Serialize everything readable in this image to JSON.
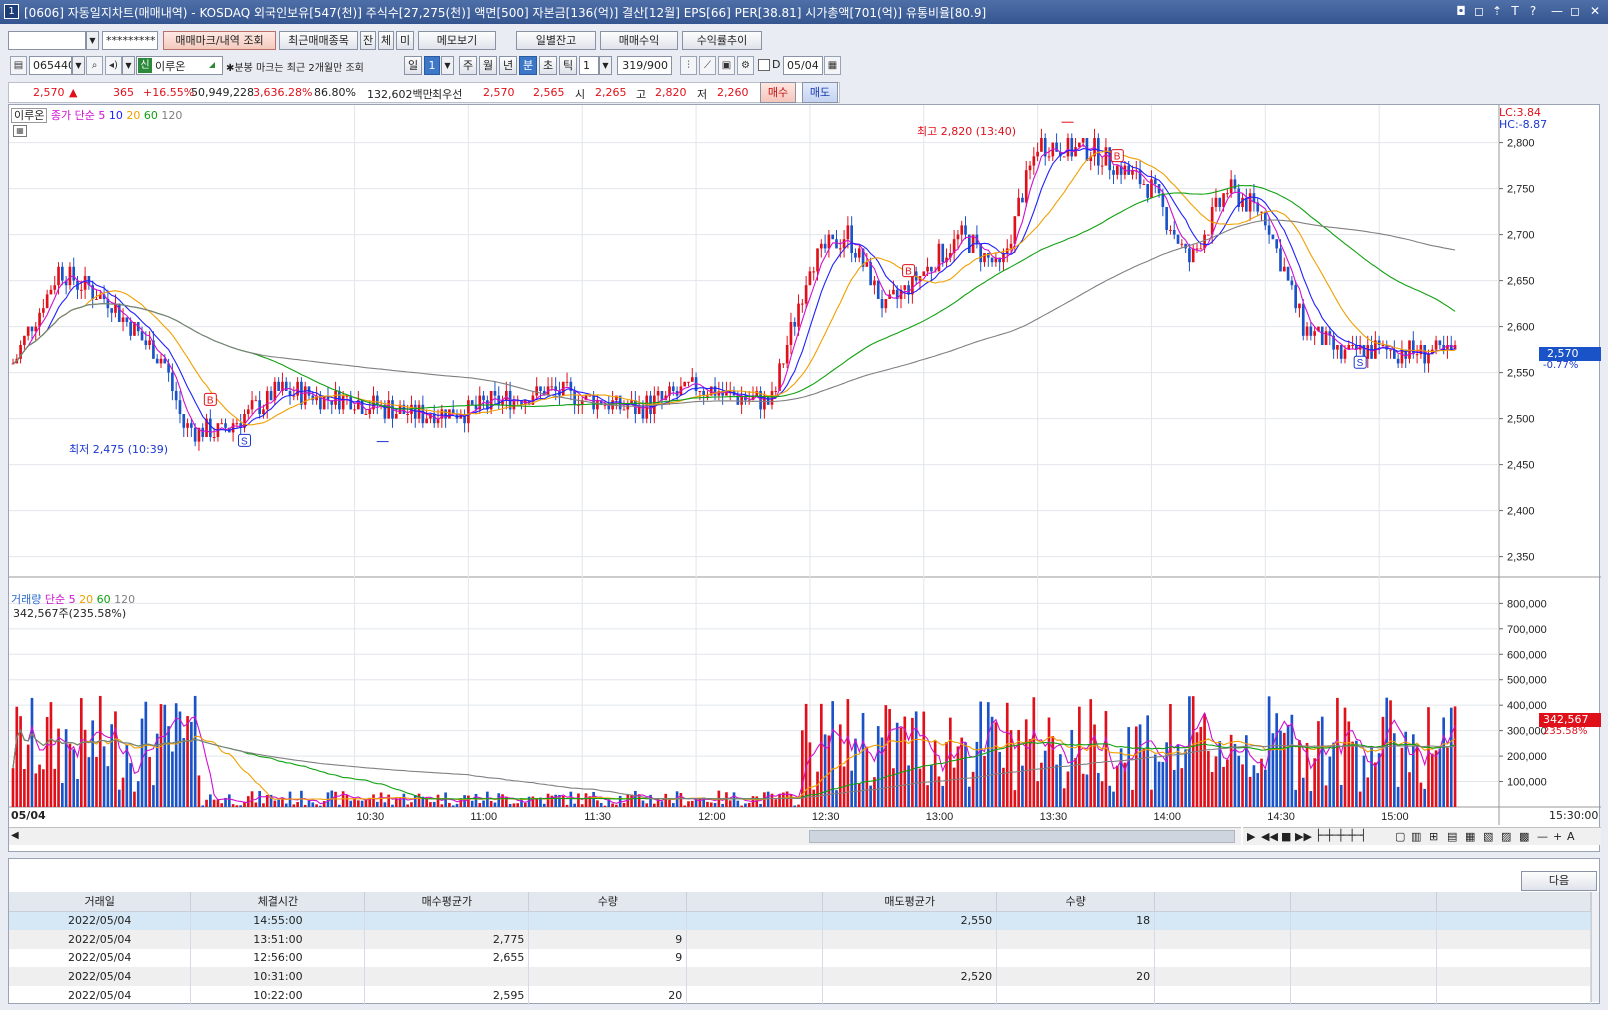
{
  "window": {
    "title": "[0606] 자동일지차트(매매내역) - KOSDAQ 외국인보유[547(천)] 주식수[27,275(천)] 액면[500] 자본금[136(억)] 결산[12월] EPS[66] PER[38.81] 시가총액[701(억)] 유통비율[80.9]",
    "icon": "1",
    "controls": [
      "◘",
      "◻",
      "⇡",
      "T",
      "?",
      "—",
      "◻",
      "✕"
    ]
  },
  "toolbar1": {
    "account_value": "",
    "password": "*********",
    "buttons": [
      "매매마크/내역 조회",
      "최근매매종목",
      "잔",
      "체",
      "미",
      "메모보기",
      "일별잔고",
      "매매수익",
      "수익률추이"
    ]
  },
  "toolbar2": {
    "code": "065440",
    "stock_tag": "신",
    "stock_name": "이루온",
    "note": "분봉 마크는 최근 2개월만 조회",
    "period_buttons": [
      "일",
      "1",
      "주",
      "월",
      "년",
      "분",
      "초",
      "틱"
    ],
    "interval": "1",
    "count": "319/900",
    "date": "05/04"
  },
  "quote": {
    "price": "2,570",
    "arrow": "▲",
    "change": "365",
    "change_rate": "+16.55%",
    "volume": "50,949,228",
    "volume_rate": "3,636.28%",
    "turnover": "86.80%",
    "amount": "132,602백만",
    "best_label": "최우선",
    "best_ask": "2,570",
    "best_bid": "2,565",
    "open_label": "시",
    "open": "2,265",
    "high_label": "고",
    "high": "2,820",
    "low_label": "저",
    "low": "2,260",
    "buy": "매수",
    "sell": "매도"
  },
  "price_panel": {
    "legend_name": "이루온",
    "legend_ma": "종가 단순",
    "ma": [
      "5",
      "10",
      "20",
      "60",
      "120"
    ],
    "ma_colors": [
      "#d010d0",
      "#2020ff",
      "#f0a000",
      "#10a010",
      "#808080"
    ],
    "high_annot": "최고 2,820 (13:40)",
    "low_annot": "최저 2,475 (10:39)",
    "lc": "LC:3.84",
    "hc": "HC:-8.87",
    "cur_label": "2,570",
    "cur_pct": "-0.77%",
    "y_ticks": [
      "2,800",
      "2,750",
      "2,700",
      "2,650",
      "2,600",
      "2,550",
      "2,500",
      "2,450",
      "2,400",
      "2,350"
    ]
  },
  "volume_panel": {
    "legend_name": "거래량",
    "legend_ma": "단순",
    "ma": [
      "5",
      "20",
      "60",
      "120"
    ],
    "summary": "342,567주(235.58%)",
    "cur_label": "342,567",
    "cur_pct": "235.58%",
    "y_ticks": [
      "800,000",
      "700,000",
      "600,000",
      "500,000",
      "400,000",
      "300,000",
      "200,000",
      "100,000"
    ]
  },
  "x_axis": {
    "date_label": "05/04",
    "ticks": [
      "10:30",
      "11:00",
      "11:30",
      "12:00",
      "12:30",
      "13:00",
      "13:30",
      "14:00",
      "14:30",
      "15:00"
    ],
    "end": "15:30:00"
  },
  "grid": {
    "next_button": "다음",
    "headers": [
      "거래일",
      "체결시간",
      "매수평균가",
      "수량",
      "",
      "매도평균가",
      "수량",
      "",
      "",
      ""
    ],
    "rows": [
      [
        "2022/05/04",
        "14:55:00",
        "",
        "",
        "",
        "2,550",
        "18",
        "",
        "",
        ""
      ],
      [
        "2022/05/04",
        "13:51:00",
        "2,775",
        "9",
        "",
        "",
        "",
        "",
        "",
        ""
      ],
      [
        "2022/05/04",
        "12:56:00",
        "2,655",
        "9",
        "",
        "",
        "",
        "",
        "",
        ""
      ],
      [
        "2022/05/04",
        "10:31:00",
        "",
        "",
        "",
        "2,520",
        "20",
        "",
        "",
        ""
      ],
      [
        "2022/05/04",
        "10:22:00",
        "2,595",
        "20",
        "",
        "",
        "",
        "",
        "",
        ""
      ]
    ]
  },
  "chart_data": {
    "type": "candlestick",
    "title": "",
    "x_unit": "time",
    "y_unit": "KRW",
    "price_ylim": [
      2330,
      2830
    ],
    "volume_ylim": [
      0,
      880000
    ],
    "high": {
      "value": 2820,
      "time": "13:40"
    },
    "low": {
      "value": 2475,
      "time": "10:39"
    },
    "anchors": [
      [
        "09:00",
        2560
      ],
      [
        "09:12",
        2660
      ],
      [
        "09:25",
        2630
      ],
      [
        "09:40",
        2560
      ],
      [
        "09:45",
        2490
      ],
      [
        "09:55",
        2485
      ],
      [
        "10:10",
        2530
      ],
      [
        "10:30",
        2520
      ],
      [
        "10:45",
        2505
      ],
      [
        "11:00",
        2510
      ],
      [
        "11:20",
        2530
      ],
      [
        "11:45",
        2510
      ],
      [
        "12:00",
        2535
      ],
      [
        "12:15",
        2520
      ],
      [
        "12:20",
        2518
      ],
      [
        "12:30",
        2670
      ],
      [
        "12:40",
        2700
      ],
      [
        "12:50",
        2620
      ],
      [
        "13:00",
        2660
      ],
      [
        "13:10",
        2700
      ],
      [
        "13:20",
        2660
      ],
      [
        "13:30",
        2800
      ],
      [
        "13:45",
        2790
      ],
      [
        "14:00",
        2750
      ],
      [
        "14:10",
        2670
      ],
      [
        "14:20",
        2750
      ],
      [
        "14:30",
        2720
      ],
      [
        "14:40",
        2600
      ],
      [
        "14:50",
        2570
      ],
      [
        "15:00",
        2575
      ],
      [
        "15:20",
        2570
      ]
    ],
    "trade_marks": [
      {
        "type": "B",
        "time": "09:52"
      },
      {
        "type": "S",
        "time": "10:01"
      },
      {
        "type": "B",
        "time": "12:56"
      },
      {
        "type": "B",
        "time": "13:51"
      },
      {
        "type": "S",
        "time": "14:55"
      }
    ]
  }
}
